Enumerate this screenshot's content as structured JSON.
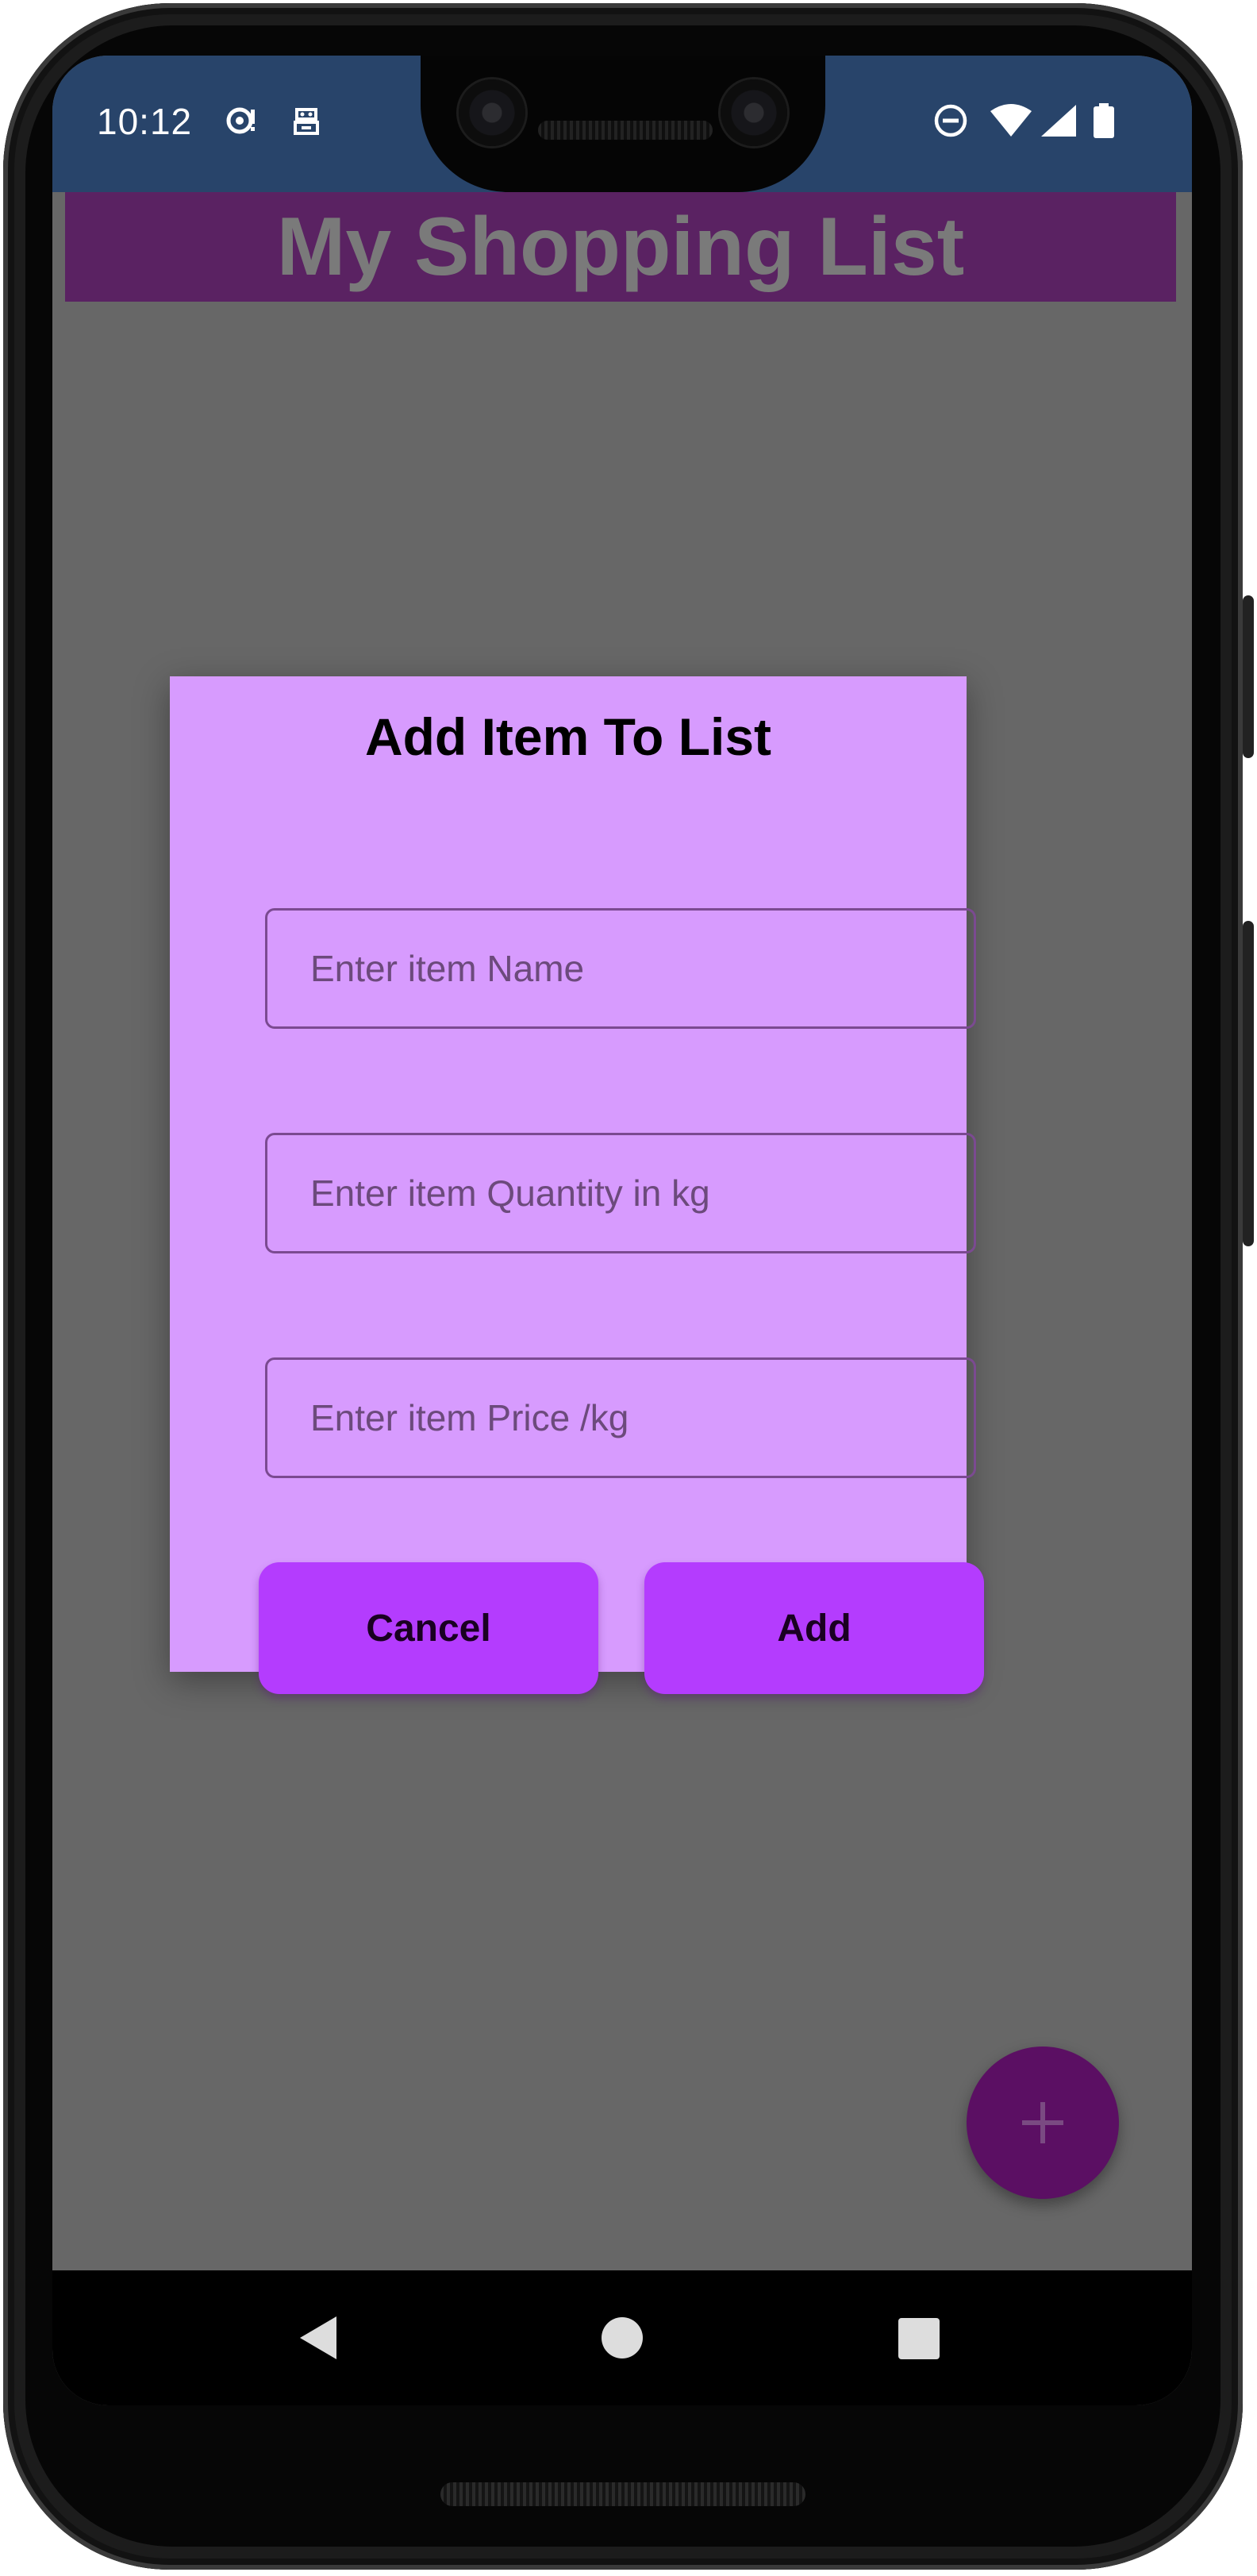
{
  "status_bar": {
    "time": "10:12",
    "left_icons": [
      "media-sync-icon",
      "accessibility-icon"
    ],
    "right_icons": [
      "do-not-disturb-icon",
      "wifi-icon",
      "cell-signal-icon",
      "battery-icon"
    ]
  },
  "app_bar": {
    "title": "My Shopping List",
    "background": "#5a2262"
  },
  "dialog": {
    "title": "Add Item To List",
    "background": "#d79bfe",
    "fields": [
      {
        "name": "item-name",
        "placeholder": "Enter item Name",
        "value": ""
      },
      {
        "name": "item-quantity",
        "placeholder": "Enter item Quantity in kg",
        "value": ""
      },
      {
        "name": "item-price",
        "placeholder": "Enter item Price /kg",
        "value": ""
      }
    ],
    "cancel_label": "Cancel",
    "add_label": "Add",
    "button_color": "#b43cfe"
  },
  "fab": {
    "icon": "plus-icon",
    "color": "#5b0f63"
  },
  "nav_bar": {
    "icons": [
      "back-icon",
      "home-icon",
      "recents-icon"
    ]
  }
}
